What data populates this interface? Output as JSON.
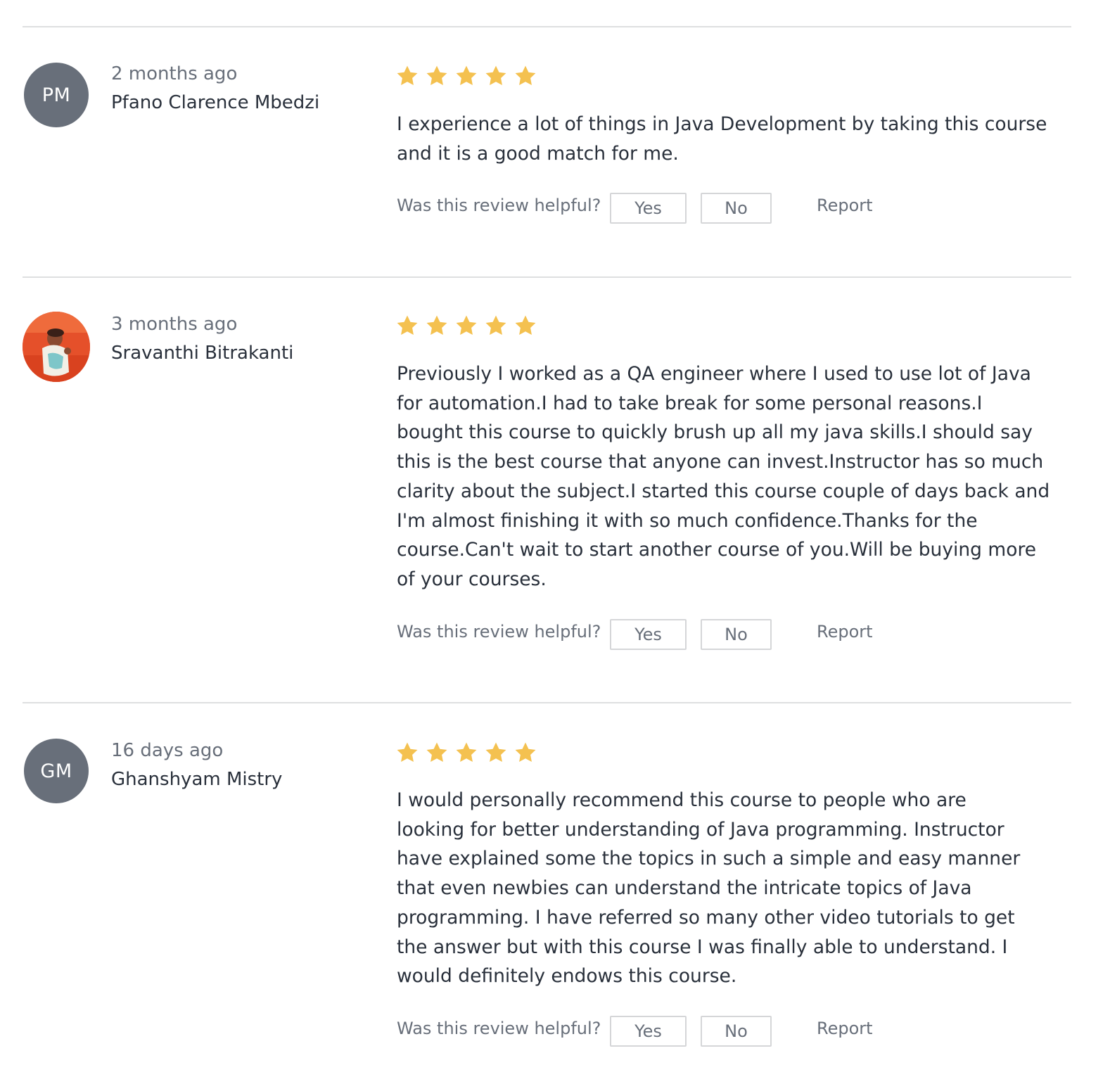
{
  "colors": {
    "star": "#f4c150",
    "avatar_bg": "#686f7a",
    "text_primary": "#29303b",
    "text_secondary": "#686f7a",
    "divider": "#dedfe0"
  },
  "reviews": [
    {
      "avatar_initials": "PM",
      "time_ago": "2 months ago",
      "reviewer_name": "Pfano Clarence Mbedzi",
      "rating": 5,
      "text": "I experience a lot of things in Java Development by taking this course\nand it is a good match for me.",
      "helpful_label": "Was this review helpful?",
      "yes_label": "Yes",
      "no_label": "No",
      "report_label": "Report"
    },
    {
      "avatar_initials": "",
      "avatar_image": "reviewer-photo",
      "time_ago": "3 months ago",
      "reviewer_name": "Sravanthi Bitrakanti",
      "rating": 5,
      "text": "Previously I worked as a QA engineer where I used to use lot of Java\nfor automation.I had to take break for some personal reasons.I\nbought this course to quickly brush up all my java skills.I should say\nthis is the best course that anyone can invest.Instructor has so much\nclarity about the subject.I started this course couple of days back and\nI'm almost finishing it with so much confidence.Thanks for the\ncourse.Can't wait to start another course of you.Will be buying more\nof your courses.",
      "helpful_label": "Was this review helpful?",
      "yes_label": "Yes",
      "no_label": "No",
      "report_label": "Report"
    },
    {
      "avatar_initials": "GM",
      "time_ago": "16 days ago",
      "reviewer_name": "Ghanshyam Mistry",
      "rating": 5,
      "text": "I would personally recommend this course to people who are\nlooking for better understanding of Java programming. Instructor\nhave explained some the topics in such a simple and easy manner\nthat even newbies can understand the intricate topics of Java\nprogramming. I have referred so many other video tutorials to get\nthe answer but with this course I was finally able to understand. I\nwould definitely endows this course.",
      "helpful_label": "Was this review helpful?",
      "yes_label": "Yes",
      "no_label": "No",
      "report_label": "Report"
    }
  ]
}
